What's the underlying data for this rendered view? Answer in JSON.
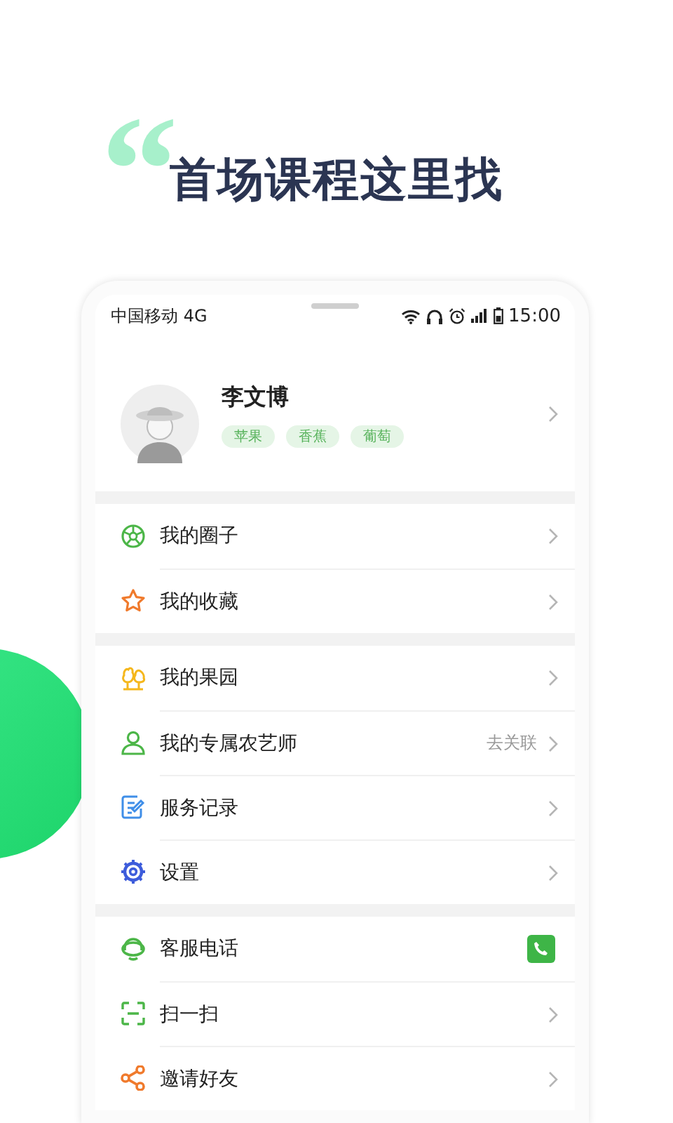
{
  "quote_mark": "“",
  "headline": "首场课程这里找",
  "status_bar": {
    "carrier": "中国移动 4G",
    "time": "15:00"
  },
  "profile": {
    "name": "李文博",
    "tags": [
      "苹果",
      "香蕉",
      "葡萄"
    ]
  },
  "groups": [
    {
      "items": [
        {
          "label": "我的圈子",
          "kind": "chevron"
        },
        {
          "label": "我的收藏",
          "kind": "chevron"
        }
      ]
    },
    {
      "items": [
        {
          "label": "我的果园",
          "kind": "chevron"
        },
        {
          "label": "我的专属农艺师",
          "kind": "chevron",
          "action": "去关联"
        },
        {
          "label": "服务记录",
          "kind": "chevron"
        },
        {
          "label": "设置",
          "kind": "chevron"
        }
      ]
    },
    {
      "items": [
        {
          "label": "客服电话",
          "kind": "call"
        },
        {
          "label": "扫一扫",
          "kind": "chevron"
        },
        {
          "label": "邀请好友",
          "kind": "chevron"
        }
      ]
    }
  ]
}
